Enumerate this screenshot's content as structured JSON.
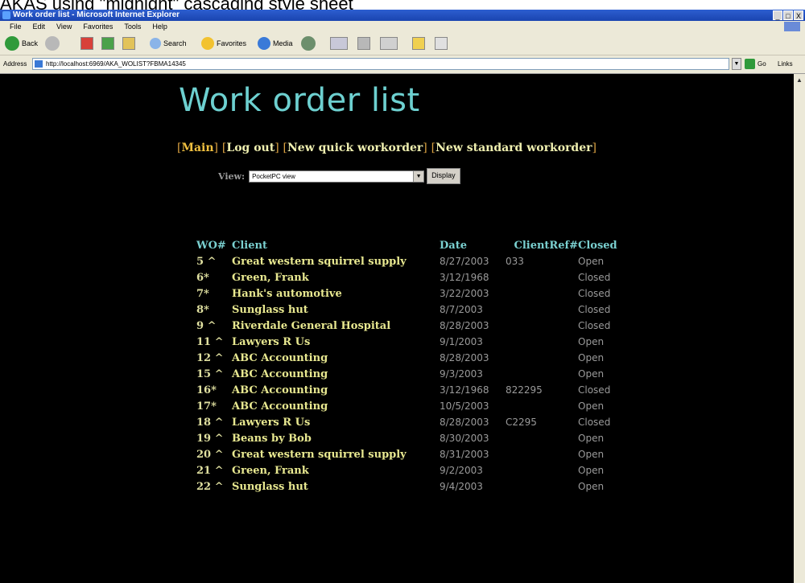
{
  "caption": "AKAS using \"midnight\" cascading style sheet",
  "window": {
    "title": "Work order list - Microsoft Internet Explorer",
    "buttons": [
      "_",
      "□",
      "X"
    ]
  },
  "menu": [
    "File",
    "Edit",
    "View",
    "Favorites",
    "Tools",
    "Help"
  ],
  "toolbar": {
    "back": "Back",
    "search": "Search",
    "favorites": "Favorites",
    "media": "Media"
  },
  "address": {
    "label": "Address",
    "url": "http://localhost:6969/AKA_WOLIST?FBMA14345",
    "go": "Go",
    "links": "Links"
  },
  "page": {
    "heading": "Work order list",
    "nav": [
      "Main",
      "Log out",
      "New quick workorder",
      "New standard workorder"
    ],
    "view_label": "View:",
    "view_selected": "PocketPC view",
    "display_button": "Display"
  },
  "table": {
    "headers": [
      "WO#",
      "Client",
      "Date",
      "ClientRef#",
      "Closed"
    ],
    "rows": [
      {
        "wo": "5 ^",
        "client": "Great western squirrel supply",
        "date": "8/27/2003",
        "ref": "033",
        "closed": "Open"
      },
      {
        "wo": "6*",
        "client": "Green, Frank",
        "date": "3/12/1968",
        "ref": "",
        "closed": "Closed"
      },
      {
        "wo": "7*",
        "client": "Hank's automotive",
        "date": "3/22/2003",
        "ref": "",
        "closed": "Closed"
      },
      {
        "wo": "8*",
        "client": "Sunglass hut",
        "date": "8/7/2003",
        "ref": "",
        "closed": "Closed"
      },
      {
        "wo": "9 ^",
        "client": "Riverdale General Hospital",
        "date": "8/28/2003",
        "ref": "",
        "closed": "Closed"
      },
      {
        "wo": "11 ^",
        "client": "Lawyers R Us",
        "date": "9/1/2003",
        "ref": "",
        "closed": "Open"
      },
      {
        "wo": "12 ^",
        "client": "ABC Accounting",
        "date": "8/28/2003",
        "ref": "",
        "closed": "Open"
      },
      {
        "wo": "15 ^",
        "client": "ABC Accounting",
        "date": "9/3/2003",
        "ref": "",
        "closed": "Open"
      },
      {
        "wo": "16*",
        "client": "ABC Accounting",
        "date": "3/12/1968",
        "ref": "822295",
        "closed": "Closed"
      },
      {
        "wo": "17*",
        "client": "ABC Accounting",
        "date": "10/5/2003",
        "ref": "",
        "closed": "Open"
      },
      {
        "wo": "18 ^",
        "client": "Lawyers R Us",
        "date": "8/28/2003",
        "ref": "C2295",
        "closed": "Closed"
      },
      {
        "wo": "19 ^",
        "client": "Beans by Bob",
        "date": "8/30/2003",
        "ref": "",
        "closed": "Open"
      },
      {
        "wo": "20 ^",
        "client": "Great western squirrel supply",
        "date": "8/31/2003",
        "ref": "",
        "closed": "Open"
      },
      {
        "wo": "21 ^",
        "client": "Green, Frank",
        "date": "9/2/2003",
        "ref": "",
        "closed": "Open"
      },
      {
        "wo": "22 ^",
        "client": "Sunglass hut",
        "date": "9/4/2003",
        "ref": "",
        "closed": "Open"
      }
    ]
  },
  "colors": {
    "background": "#000000",
    "heading": "#6dd0d0",
    "client_text": "#e8e890",
    "muted_text": "#9a9a9a"
  }
}
